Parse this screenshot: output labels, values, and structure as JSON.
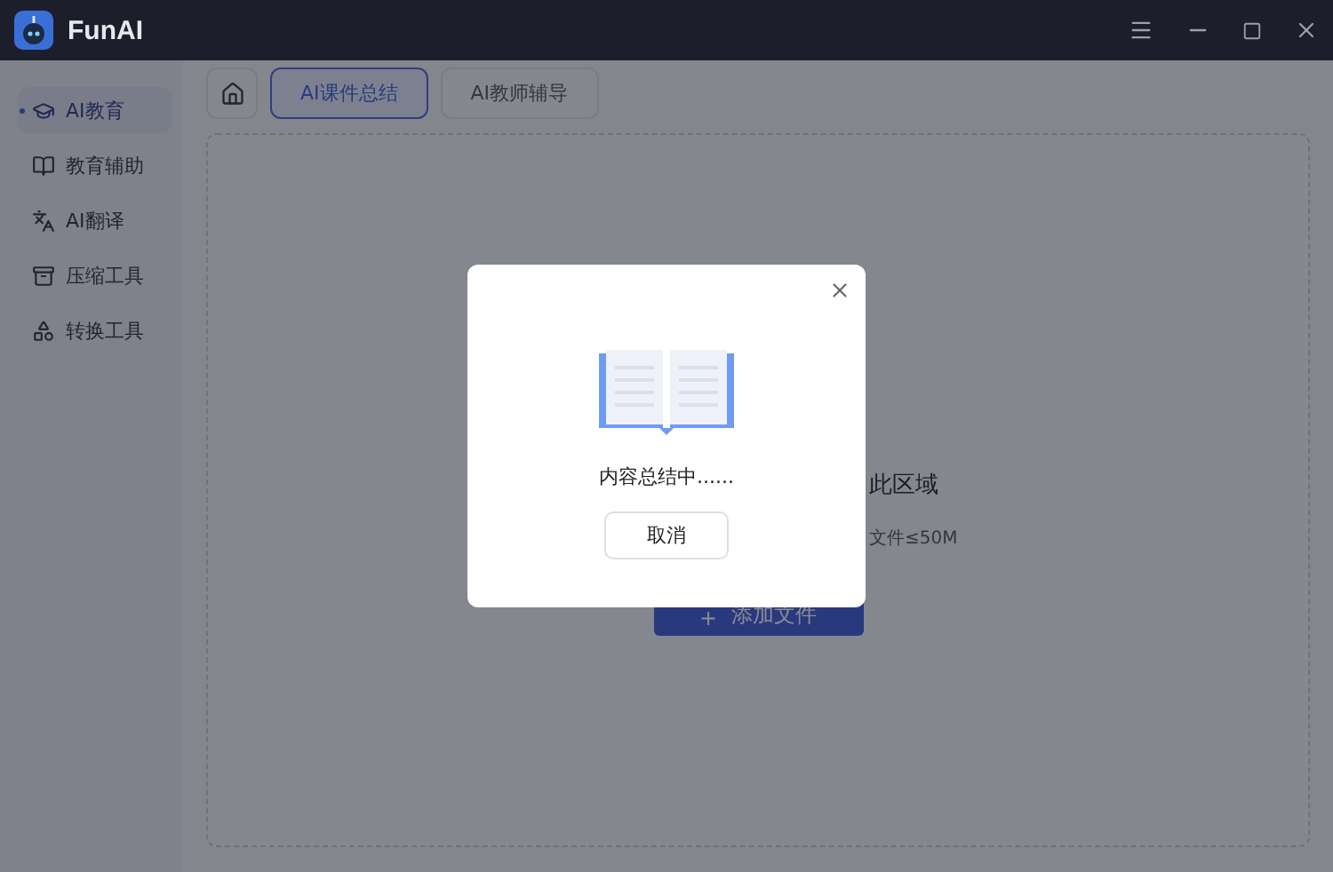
{
  "window": {
    "title": "FunAI"
  },
  "sidebar": {
    "items": [
      {
        "label": "AI教育",
        "selected": true
      },
      {
        "label": "教育辅助",
        "selected": false
      },
      {
        "label": "AI翻译",
        "selected": false
      },
      {
        "label": "压缩工具",
        "selected": false
      },
      {
        "label": "转换工具",
        "selected": false
      }
    ]
  },
  "tabs": [
    {
      "label": "AI课件总结",
      "selected": true
    },
    {
      "label": "AI教师辅导",
      "selected": false
    }
  ],
  "upload": {
    "title": "此区域",
    "hint": "文件≤50M",
    "button": "添加文件",
    "button_icon": "+"
  },
  "dialog": {
    "message": "内容总结中......",
    "cancel": "取消"
  }
}
